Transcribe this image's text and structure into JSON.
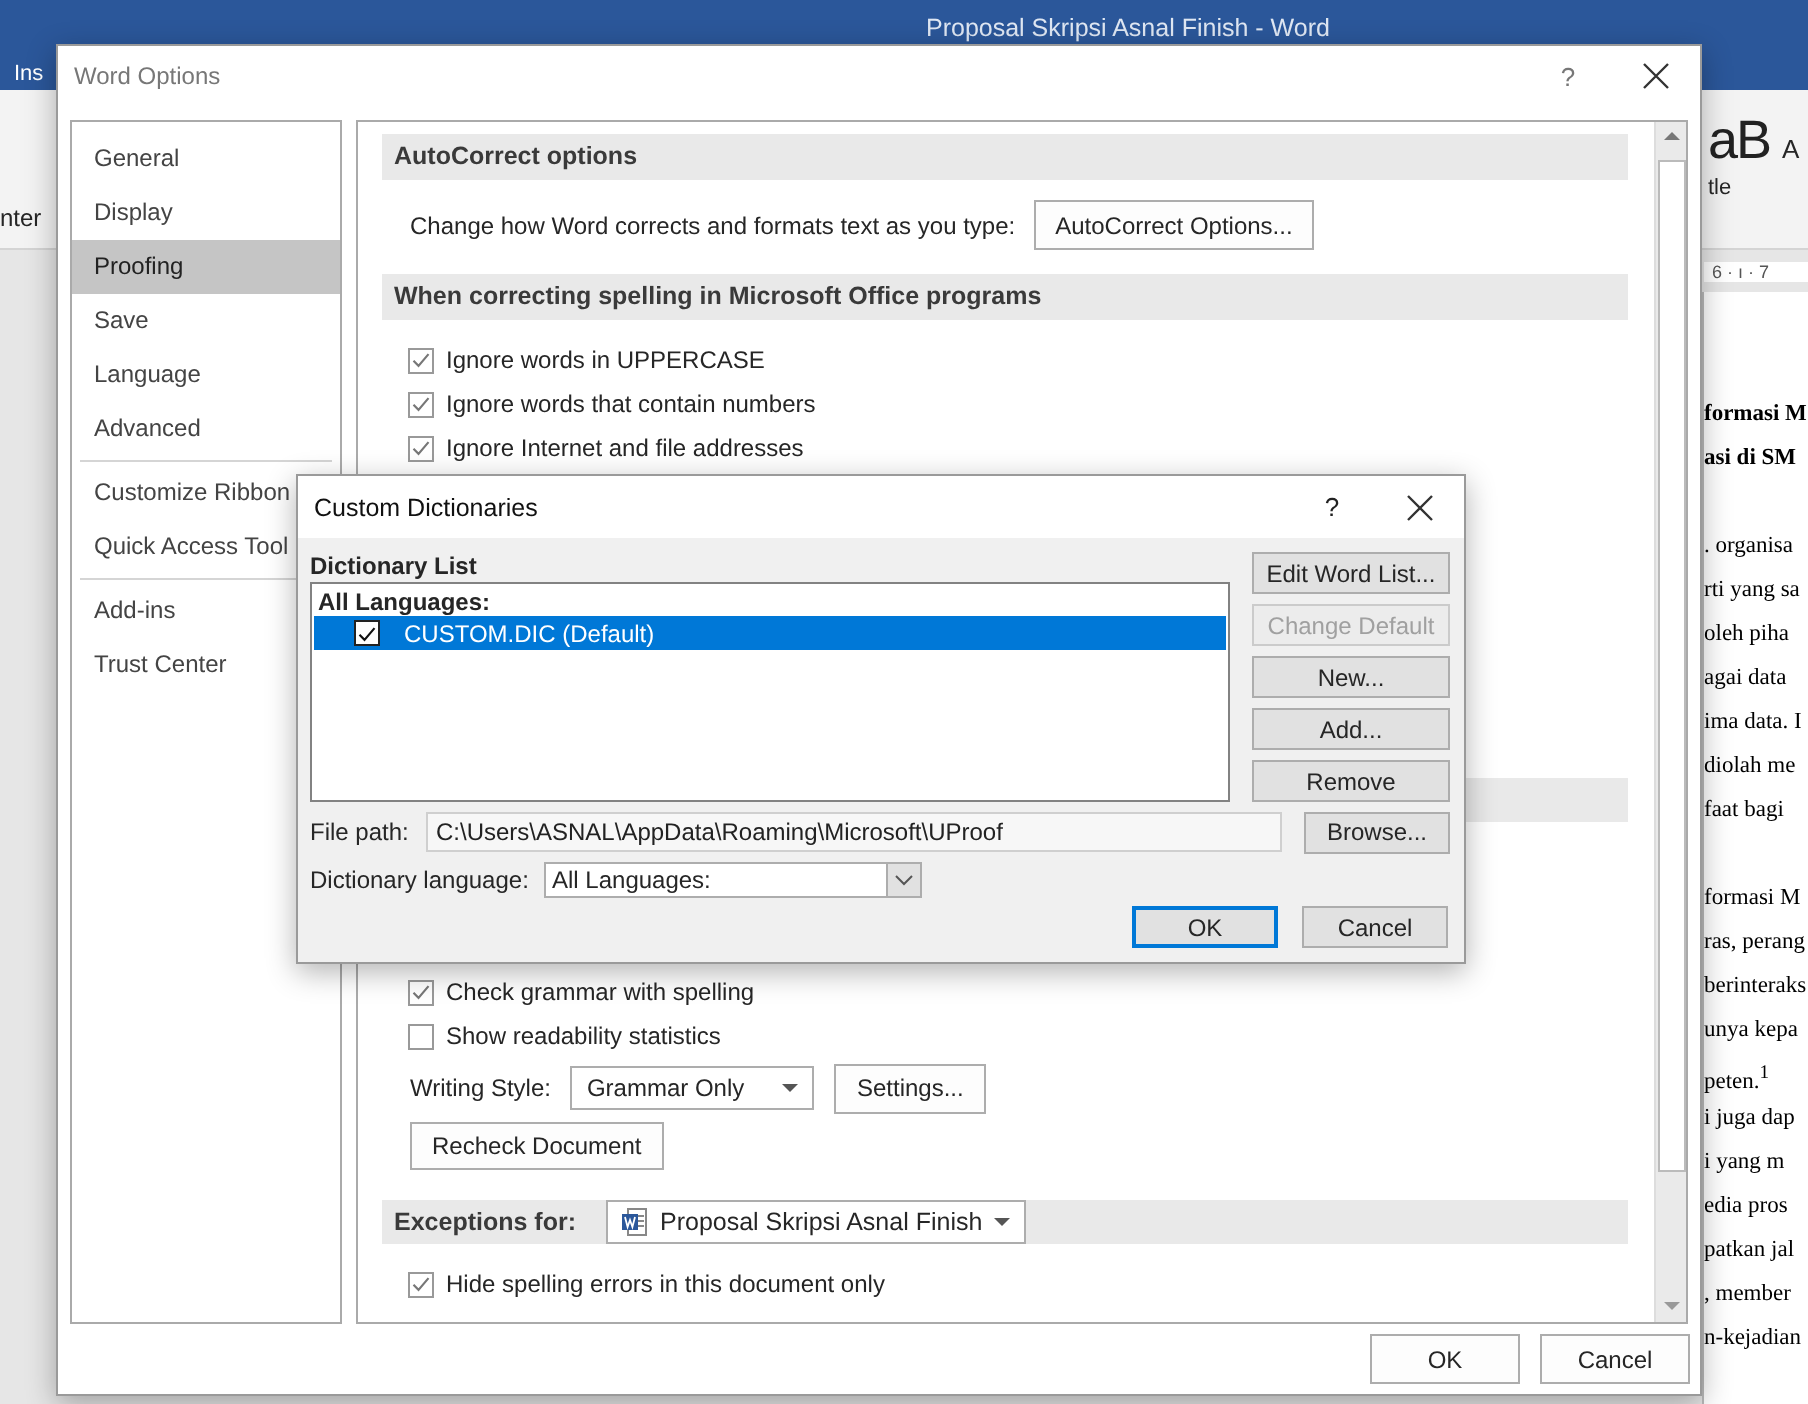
{
  "word_window": {
    "title": "Proposal Skripsi Asnal Finish - Word",
    "ribbon_tab": "Ins",
    "ribbon_left": "nter",
    "style_sample": "aB",
    "style_next": "A",
    "style_name": "tle",
    "ruler": "6 · ı · 7",
    "document_paragraphs": [
      {
        "bold": true,
        "lines": [
          "formasi M",
          "asi di SM"
        ]
      },
      {
        "bold": false,
        "lines": [
          ". organisa",
          "rti yang sa",
          "oleh piha",
          "agai data",
          "ima data. I",
          "diolah me",
          "faat  bagi"
        ]
      },
      {
        "bold": false,
        "lines": [
          "formasi M",
          "ras, perang",
          "berinteraks",
          "unya kepa",
          "peten.$^{1}$",
          "i juga dap",
          "i yang m",
          "edia pros",
          "patkan jal",
          ", member",
          "n-kejadian"
        ]
      }
    ]
  },
  "word_options": {
    "title": "Word Options",
    "help": "?",
    "nav_groups": [
      [
        {
          "label": "General",
          "selected": false
        },
        {
          "label": "Display",
          "selected": false
        },
        {
          "label": "Proofing",
          "selected": true
        },
        {
          "label": "Save",
          "selected": false
        },
        {
          "label": "Language",
          "selected": false
        },
        {
          "label": "Advanced",
          "selected": false
        }
      ],
      [
        {
          "label": "Customize Ribbon",
          "selected": false
        },
        {
          "label": "Quick Access Tool",
          "selected": false
        }
      ],
      [
        {
          "label": "Add-ins",
          "selected": false
        },
        {
          "label": "Trust Center",
          "selected": false
        }
      ]
    ],
    "upper_rows": [
      {
        "kind": "header",
        "text": "AutoCorrect options"
      },
      {
        "kind": "action",
        "text": "Change how Word corrects and formats text as you type:",
        "button": "AutoCorrect Options..."
      },
      {
        "kind": "header",
        "text": "When correcting spelling in Microsoft Office programs"
      },
      {
        "kind": "checkbox",
        "label": "Ignore words in UPPERCASE",
        "checked": true
      },
      {
        "kind": "checkbox",
        "label": "Ignore words that contain numbers",
        "checked": true
      },
      {
        "kind": "checkbox",
        "label": "Ignore Internet and file addresses",
        "checked": true
      }
    ],
    "lower_rows": [
      {
        "kind": "checkbox",
        "label": "Check grammar with spelling",
        "checked": true
      },
      {
        "kind": "checkbox",
        "label": "Show readability statistics",
        "checked": false
      },
      {
        "kind": "select",
        "label": "Writing Style:",
        "value": "Grammar Only",
        "button": "Settings..."
      },
      {
        "kind": "button",
        "button": "Recheck Document"
      },
      {
        "kind": "doc_header",
        "text": "Exceptions for:",
        "value": "Proposal Skripsi Asnal Finish"
      },
      {
        "kind": "checkbox",
        "label": "Hide spelling errors in this document only",
        "checked": true
      }
    ],
    "buttons": [
      "OK",
      "Cancel"
    ]
  },
  "custom_dictionaries": {
    "title": "Custom Dictionaries",
    "help": "?",
    "list_label": "Dictionary List",
    "group": "All Languages:",
    "items": [
      {
        "label": "CUSTOM.DIC (Default)",
        "checked": true,
        "selected": true
      }
    ],
    "side_buttons": [
      {
        "label": "Edit Word List...",
        "disabled": false
      },
      {
        "label": "Change Default",
        "disabled": true
      },
      {
        "label": "New...",
        "disabled": false
      },
      {
        "label": "Add...",
        "disabled": false
      },
      {
        "label": "Remove",
        "disabled": false
      }
    ],
    "file_path_label": "File path:",
    "file_path": "C:\\Users\\ASNAL\\AppData\\Roaming\\Microsoft\\UProof",
    "browse": "Browse...",
    "language_label": "Dictionary language:",
    "language": "All Languages:",
    "buttons": [
      {
        "label": "OK",
        "default": true
      },
      {
        "label": "Cancel",
        "default": false
      }
    ]
  }
}
